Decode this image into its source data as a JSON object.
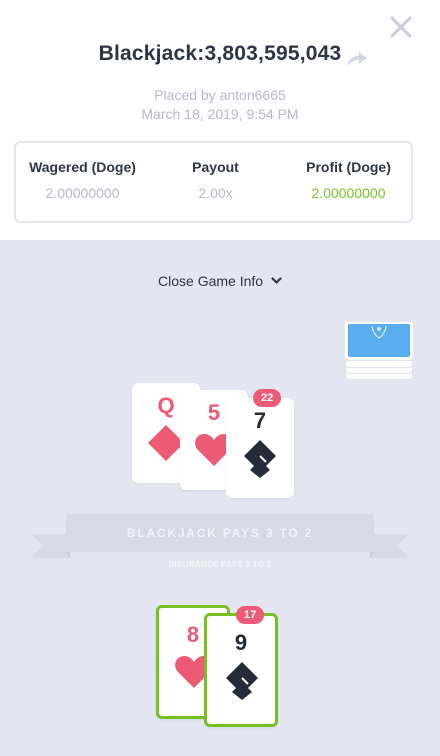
{
  "header": {
    "title": "Blackjack:3,803,595,043",
    "placed_by": "Placed by anton6665",
    "date": "March 18, 2019, 9:54 PM"
  },
  "stats": {
    "wagered": {
      "label": "Wagered (Doge)",
      "value": "2.00000000"
    },
    "payout": {
      "label": "Payout",
      "value": "2.00x"
    },
    "profit": {
      "label": "Profit (Doge)",
      "value": "2.00000000"
    }
  },
  "toggle_label": "Close Game Info",
  "dealer": {
    "total": "22",
    "cards": [
      {
        "rank": "Q",
        "suit": "diamond"
      },
      {
        "rank": "5",
        "suit": "heart"
      },
      {
        "rank": "7",
        "suit": "spade"
      }
    ]
  },
  "table": {
    "banner": "BLACKJACK PAYS 3 TO 2",
    "insurance": "INSURANCE PAYS 2 TO 1"
  },
  "player": {
    "total": "17",
    "cards": [
      {
        "rank": "8",
        "suit": "heart"
      },
      {
        "rank": "9",
        "suit": "spade"
      }
    ]
  },
  "colors": {
    "profit": "#7bc22a",
    "win_border": "#77c023",
    "red_suit": "#ec5a75",
    "dark_suit": "#262b3a",
    "table_bg": "#e3e5f0"
  },
  "icons": [
    "close-icon",
    "share-icon",
    "chevron-down-icon",
    "diamond-icon",
    "heart-icon",
    "spade-icon"
  ]
}
